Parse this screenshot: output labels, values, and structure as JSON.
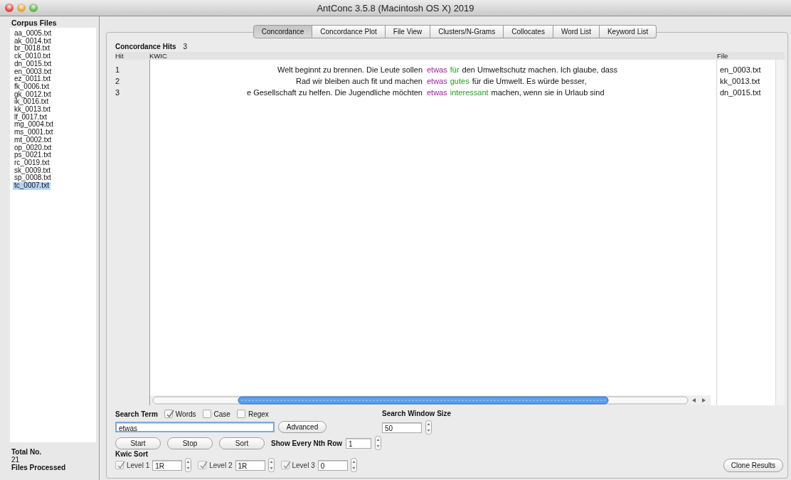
{
  "window": {
    "title": "AntConc 3.5.8 (Macintosh OS X) 2019"
  },
  "sidebar": {
    "title": "Corpus Files",
    "files": [
      {
        "name": "aa_0005.txt",
        "selected": false
      },
      {
        "name": "ak_0014.txt",
        "selected": false
      },
      {
        "name": "br_0018.txt",
        "selected": false
      },
      {
        "name": "ck_0010.txt",
        "selected": false
      },
      {
        "name": "dn_0015.txt",
        "selected": false
      },
      {
        "name": "en_0003.txt",
        "selected": false
      },
      {
        "name": "ez_0011.txt",
        "selected": false
      },
      {
        "name": "fk_0006.txt",
        "selected": false
      },
      {
        "name": "gk_0012.txt",
        "selected": false
      },
      {
        "name": "ik_0016.txt",
        "selected": false
      },
      {
        "name": "kk_0013.txt",
        "selected": false
      },
      {
        "name": "lf_0017.txt",
        "selected": false
      },
      {
        "name": "mg_0004.txt",
        "selected": false
      },
      {
        "name": "ms_0001.txt",
        "selected": false
      },
      {
        "name": "mt_0002.txt",
        "selected": false
      },
      {
        "name": "op_0020.txt",
        "selected": false
      },
      {
        "name": "ps_0021.txt",
        "selected": false
      },
      {
        "name": "rc_0019.txt",
        "selected": false
      },
      {
        "name": "sk_0009.txt",
        "selected": false
      },
      {
        "name": "sp_0008.txt",
        "selected": false
      },
      {
        "name": "tc_0007.txt",
        "selected": true
      }
    ],
    "total_label": "Total No.",
    "total": "21",
    "processed_label": "Files Processed"
  },
  "tabs": [
    {
      "label": "Concordance",
      "selected": true
    },
    {
      "label": "Concordance Plot",
      "selected": false
    },
    {
      "label": "File View",
      "selected": false
    },
    {
      "label": "Clusters/N-Grams",
      "selected": false
    },
    {
      "label": "Collocates",
      "selected": false
    },
    {
      "label": "Word List",
      "selected": false
    },
    {
      "label": "Keyword List",
      "selected": false
    }
  ],
  "concordance": {
    "hits_label": "Concordance Hits",
    "hits": "3",
    "columns": [
      "Hit",
      "KWIC",
      "File"
    ],
    "rows": [
      {
        "hit": "1",
        "left": "Welt beginnt zu brennen. Die Leute sollen",
        "keyword": "etwas",
        "collocate": "für",
        "right": "den Umweltschutz machen. Ich glaube, dass",
        "file": "en_0003.txt"
      },
      {
        "hit": "2",
        "left": "Rad wir bleiben auch fit und machen",
        "keyword": "etwas",
        "collocate": "gutes",
        "right": "für die Umwelt. Es würde besser,",
        "file": "kk_0013.txt"
      },
      {
        "hit": "3",
        "left": "e Gesellschaft zu helfen. Die Jugendliche möchten",
        "keyword": "etwas",
        "collocate": "interessant",
        "right": "machen, wenn sie in Urlaub sind",
        "file": "dn_0015.txt"
      }
    ]
  },
  "search": {
    "label": "Search Term",
    "options": [
      {
        "label": "Words",
        "checked": true
      },
      {
        "label": "Case",
        "checked": false
      },
      {
        "label": "Regex",
        "checked": false
      }
    ],
    "value": "etwas",
    "advanced_button": "Advanced",
    "window_size_label": "Search Window Size",
    "window_size": "50",
    "buttons": [
      "Start",
      "Stop",
      "Sort"
    ],
    "nth_row_label": "Show Every Nth Row",
    "nth_row": "1"
  },
  "kwic_sort": {
    "title": "Kwic Sort",
    "levels": [
      {
        "label": "Level 1",
        "checked": true,
        "value": "1R"
      },
      {
        "label": "Level 2",
        "checked": true,
        "value": "1R"
      },
      {
        "label": "Level 3",
        "checked": true,
        "value": "0"
      }
    ]
  },
  "clone_button": "Clone Results"
}
